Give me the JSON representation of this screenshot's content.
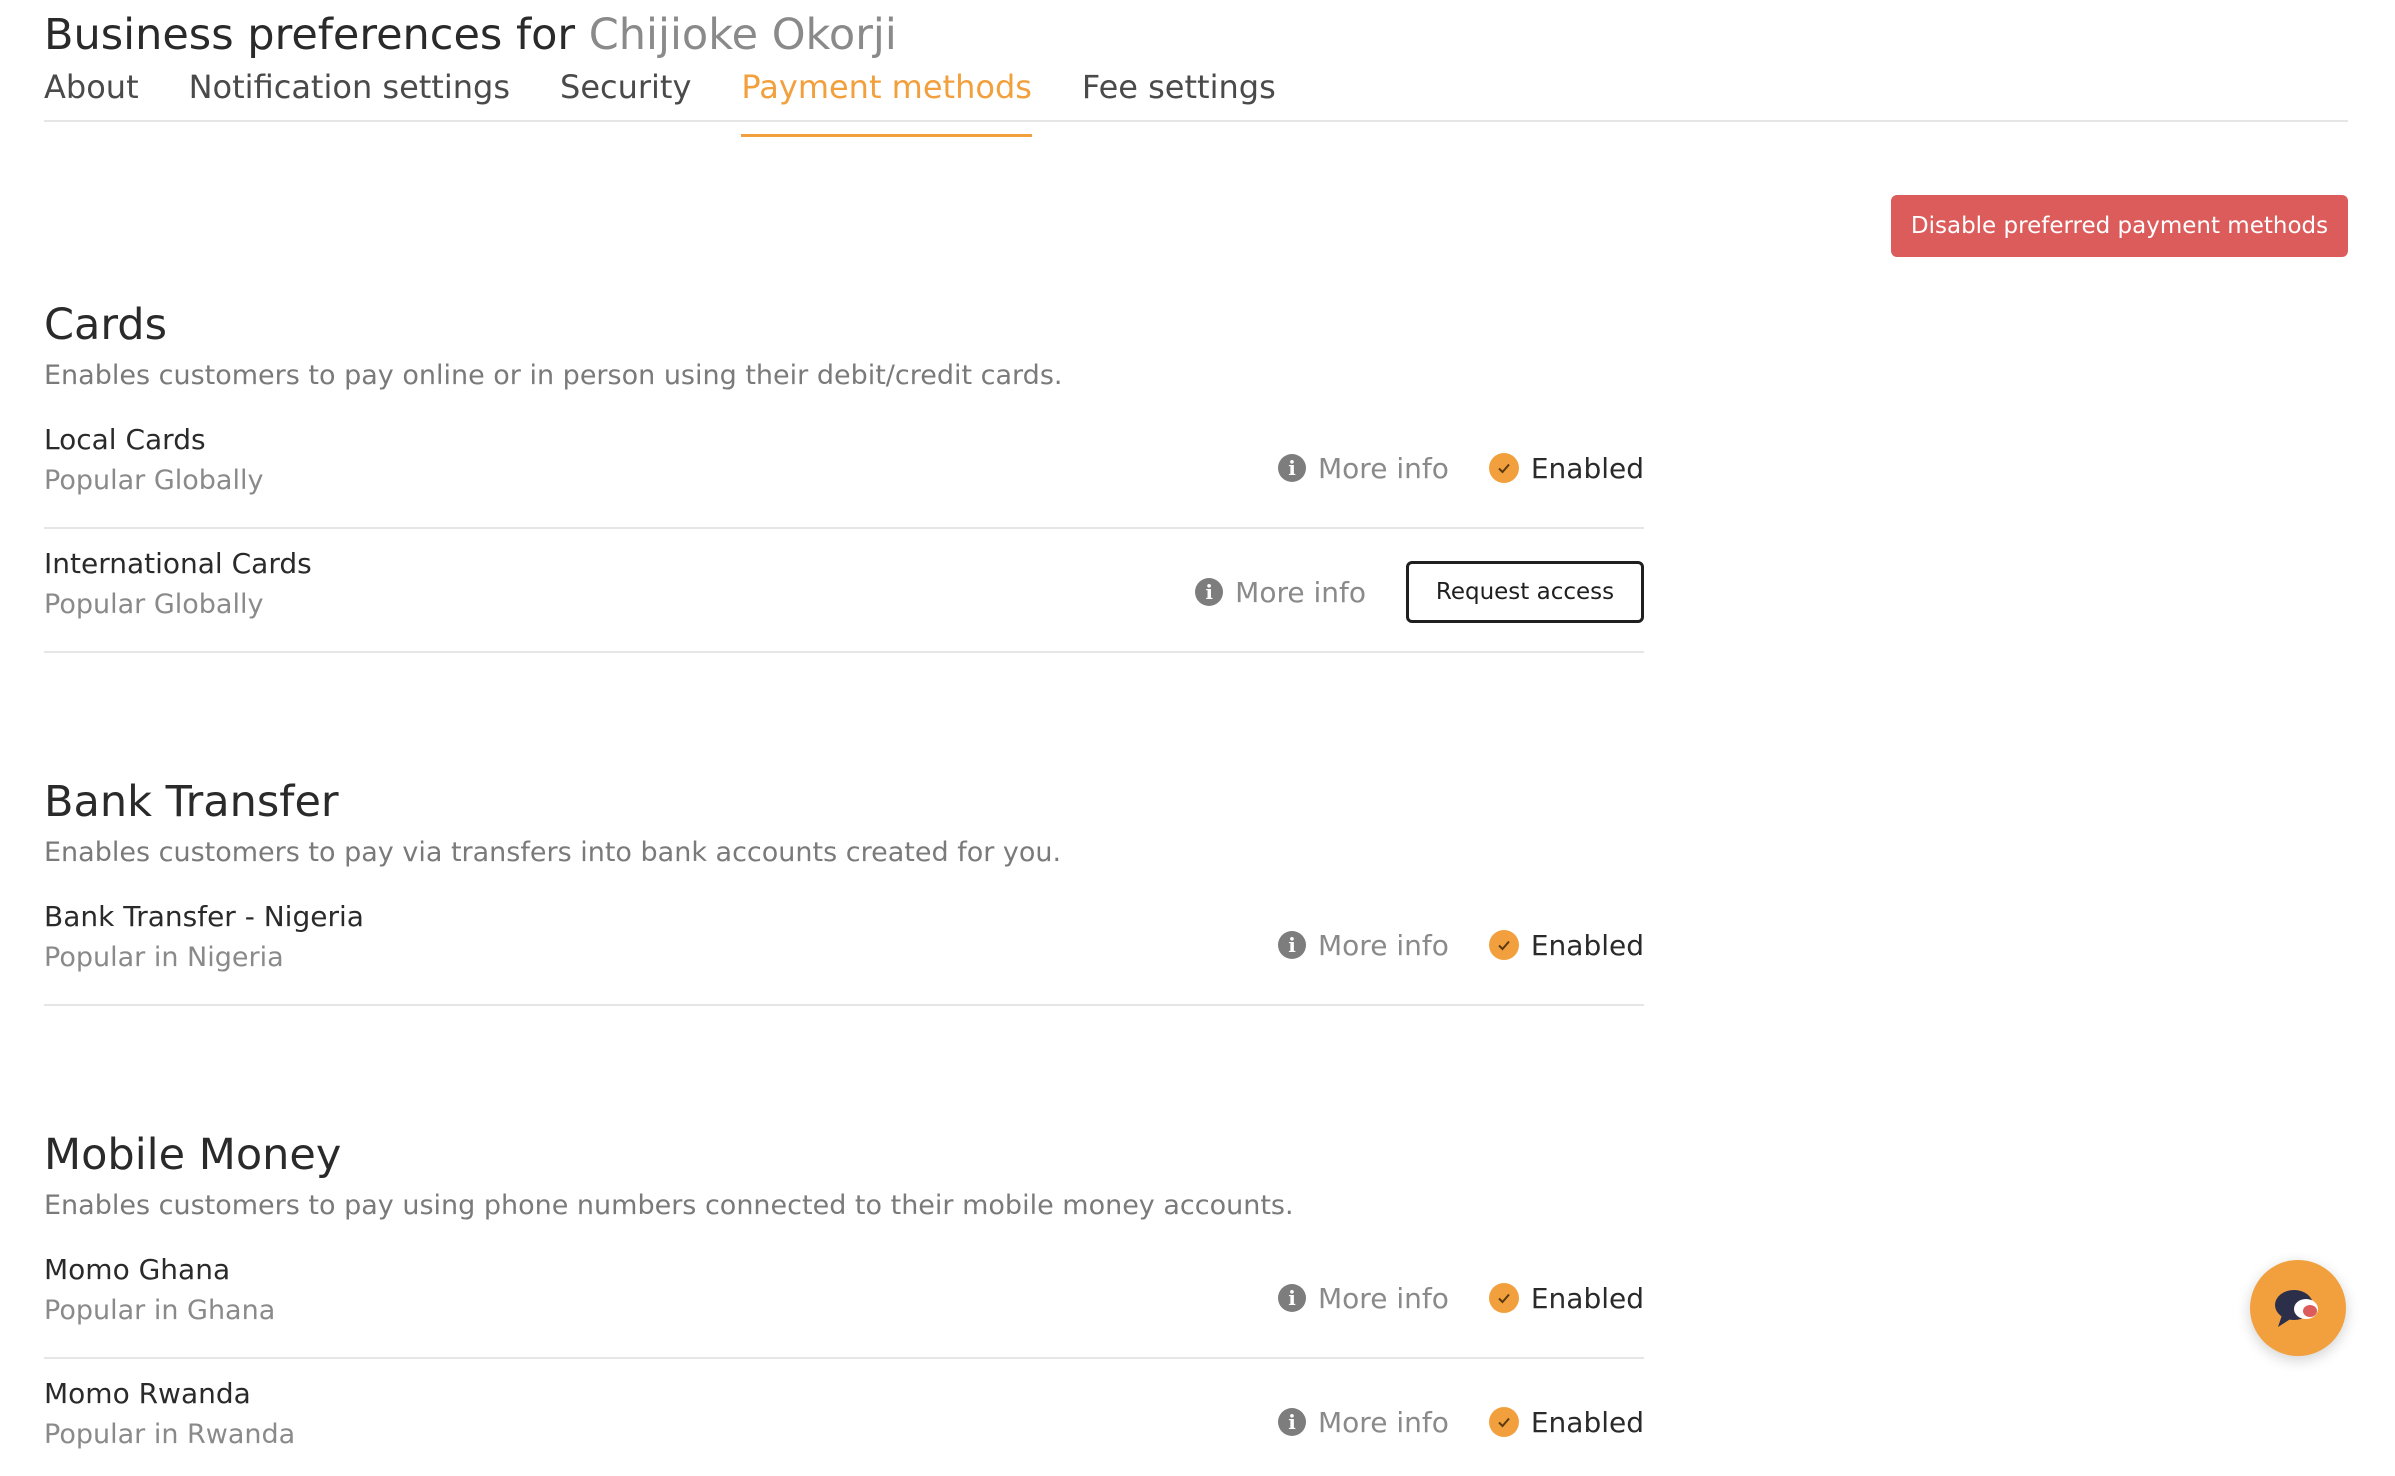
{
  "header": {
    "title_prefix": "Business preferences for",
    "user_name": "Chijioke Okorji"
  },
  "tabs": [
    {
      "label": "About",
      "active": false
    },
    {
      "label": "Notification settings",
      "active": false
    },
    {
      "label": "Security",
      "active": false
    },
    {
      "label": "Payment methods",
      "active": true
    },
    {
      "label": "Fee settings",
      "active": false
    }
  ],
  "actions": {
    "disable_preferred": "Disable preferred payment methods"
  },
  "common": {
    "more_info": "More info",
    "enabled": "Enabled",
    "request_access": "Request access"
  },
  "sections": [
    {
      "title": "Cards",
      "description": "Enables customers to pay online or in person using their debit/credit cards.",
      "methods": [
        {
          "name": "Local Cards",
          "subtitle": "Popular Globally",
          "status": "Enabled"
        },
        {
          "name": "International Cards",
          "subtitle": "Popular Globally",
          "status": "Request access"
        }
      ]
    },
    {
      "title": "Bank Transfer",
      "description": "Enables customers to pay via transfers into bank accounts created for you.",
      "methods": [
        {
          "name": "Bank Transfer - Nigeria",
          "subtitle": "Popular in Nigeria",
          "status": "Enabled"
        }
      ]
    },
    {
      "title": "Mobile Money",
      "description": "Enables customers to pay using phone numbers connected to their mobile money accounts.",
      "methods": [
        {
          "name": "Momo Ghana",
          "subtitle": "Popular in Ghana",
          "status": "Enabled"
        },
        {
          "name": "Momo Rwanda",
          "subtitle": "Popular in Rwanda",
          "status": "Enabled"
        }
      ]
    }
  ],
  "colors": {
    "accent": "#f2a03d",
    "danger": "#dc5c5c",
    "text": "#2a2a2a",
    "muted": "#8a8a8a"
  },
  "icons": {
    "info": "info-circle-icon",
    "enabled": "check-circle-icon",
    "chat": "chat-bubble-icon"
  }
}
